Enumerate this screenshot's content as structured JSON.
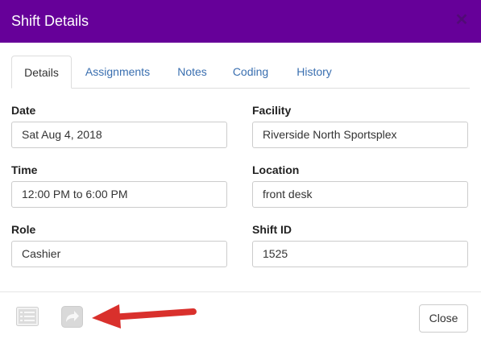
{
  "dialog": {
    "title": "Shift Details",
    "close_glyph": "✕"
  },
  "tabs": [
    {
      "label": "Details",
      "active": true
    },
    {
      "label": "Assignments",
      "active": false
    },
    {
      "label": "Notes",
      "active": false
    },
    {
      "label": "Coding",
      "active": false
    },
    {
      "label": "History",
      "active": false
    }
  ],
  "fields": {
    "date": {
      "label": "Date",
      "value": "Sat Aug 4, 2018"
    },
    "facility": {
      "label": "Facility",
      "value": "Riverside North Sportsplex"
    },
    "time": {
      "label": "Time",
      "value": "12:00 PM to 6:00 PM"
    },
    "location": {
      "label": "Location",
      "value": "front desk"
    },
    "role": {
      "label": "Role",
      "value": "Cashier"
    },
    "shift_id": {
      "label": "Shift ID",
      "value": "1525"
    }
  },
  "footer": {
    "icons": [
      "list-icon",
      "share-forward-icon"
    ],
    "close_label": "Close"
  },
  "colors": {
    "header_bg": "#660099",
    "tab_link": "#3a6fb0",
    "annotation_arrow": "#d9302c"
  }
}
